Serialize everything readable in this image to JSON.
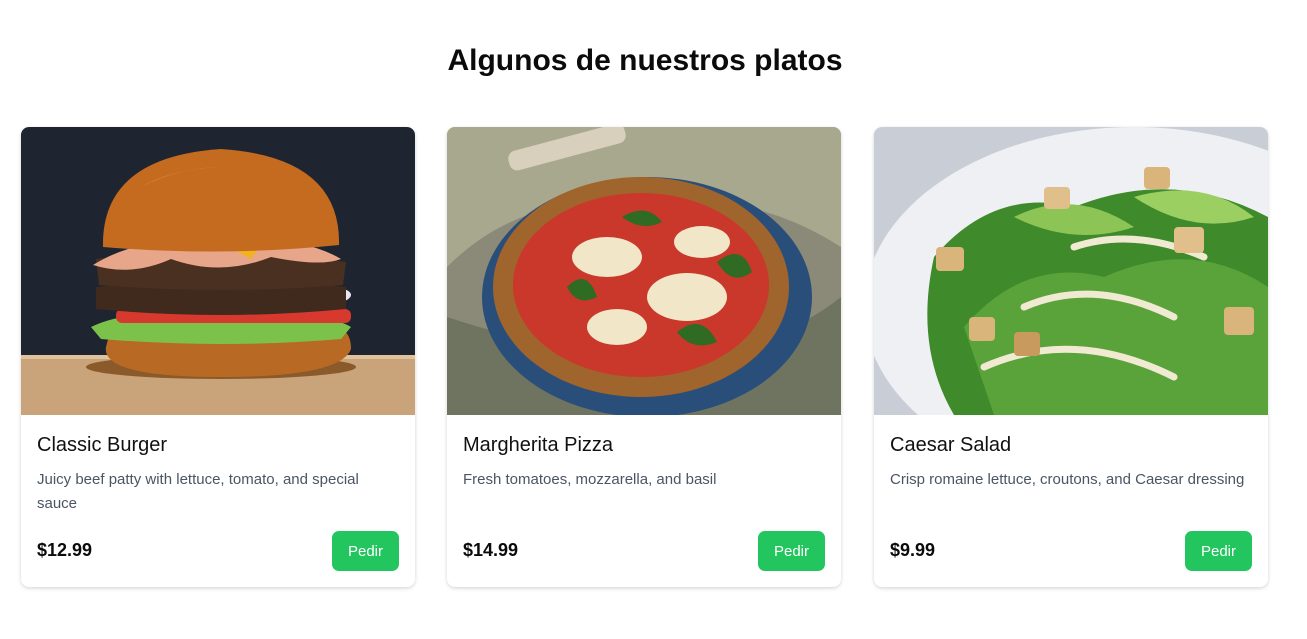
{
  "section": {
    "title": "Algunos de nuestros platos"
  },
  "dishes": [
    {
      "name": "Classic Burger",
      "description": "Juicy beef patty with lettuce, tomato, and special sauce",
      "price": "$12.99",
      "button": "Pedir"
    },
    {
      "name": "Margherita Pizza",
      "description": "Fresh tomatoes, mozzarella, and basil",
      "price": "$14.99",
      "button": "Pedir"
    },
    {
      "name": "Caesar Salad",
      "description": "Crisp romaine lettuce, croutons, and Caesar dressing",
      "price": "$9.99",
      "button": "Pedir"
    }
  ],
  "colors": {
    "accent": "#22c55e",
    "description_text": "#4b5563"
  }
}
